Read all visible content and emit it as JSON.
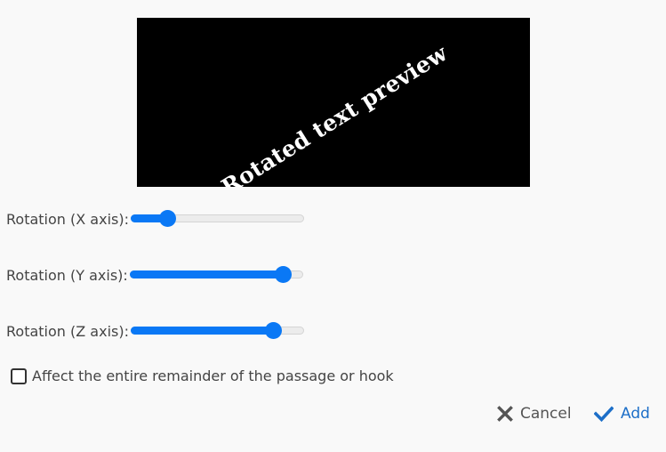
{
  "preview": {
    "text": "Rotated text preview"
  },
  "sliders": [
    {
      "label": "Rotation (X axis):",
      "value": 0.21
    },
    {
      "label": "Rotation (Y axis):",
      "value": 0.88
    },
    {
      "label": "Rotation (Z axis):",
      "value": 0.82
    }
  ],
  "checkbox": {
    "label": "Affect the entire remainder of the passage or hook",
    "checked": false
  },
  "buttons": {
    "cancel_label": "Cancel",
    "add_label": "Add"
  },
  "colors": {
    "accent": "#0a78f5",
    "add_text": "#1d6fc8",
    "preview_bg": "#000000"
  },
  "icons": {
    "cancel": "close-icon",
    "add": "checkmark-icon"
  }
}
